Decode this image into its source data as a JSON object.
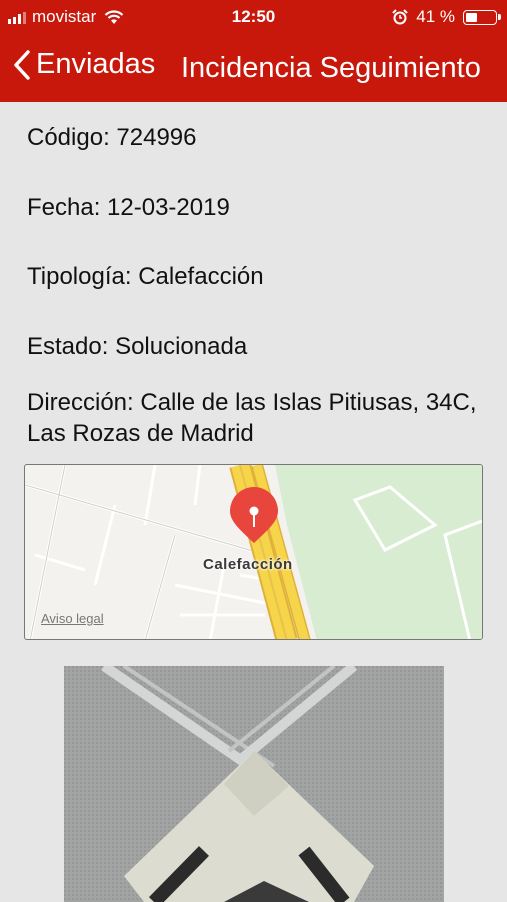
{
  "status_bar": {
    "carrier": "movistar",
    "time": "12:50",
    "battery": "41 %",
    "battery_level": 0.41
  },
  "nav": {
    "back_label": "Enviadas",
    "title": "Incidencia Seguimiento"
  },
  "incident": {
    "codigo": {
      "label": "Código",
      "value": "724996"
    },
    "fecha": {
      "label": "Fecha",
      "value": "12-03-2019"
    },
    "tipologia": {
      "label": "Tipología",
      "value": "Calefacción"
    },
    "estado": {
      "label": "Estado",
      "value": "Solucionada"
    },
    "direccion": {
      "label": "Dirección",
      "value": "Calle de las Islas Pitiusas, 34C, Las Rozas de Madrid"
    }
  },
  "map": {
    "pin_label": "Calefacción",
    "legal_link": "Aviso legal",
    "colors": {
      "pin": "#e8453c",
      "road": "#f6d54a",
      "park": "#d8ecd2"
    }
  },
  "icons": [
    "signal-icon",
    "wifi-icon",
    "alarm-icon",
    "battery-icon",
    "chevron-left-icon",
    "map-pin-icon"
  ]
}
